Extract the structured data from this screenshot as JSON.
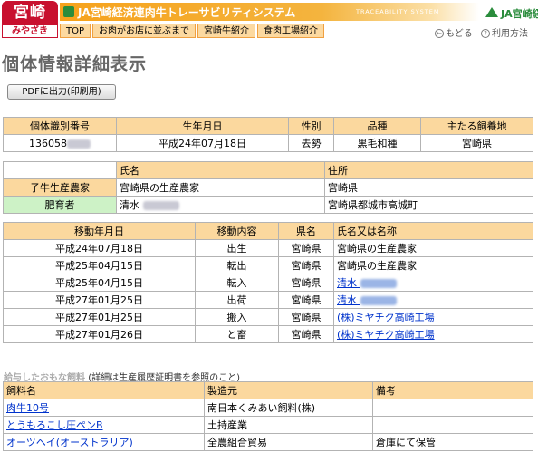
{
  "header": {
    "logo_top": "宮崎",
    "logo_bottom": "みやざき",
    "app_title": "JA宮崎経済連肉牛トレーサビリティシステム",
    "app_subtitle": "TRACEABILITY SYSTEM",
    "brand": "JA宮崎経済連",
    "nav": [
      "TOP",
      "お肉がお店に並ぶまで",
      "宮崎牛紹介",
      "食肉工場紹介"
    ],
    "back_label": "もどる",
    "help_label": "利用方法",
    "accent_color": "#f6a21c",
    "brand_color": "#2a8c3c"
  },
  "page": {
    "title": "個体情報詳細表示",
    "pdf_button": "PDFに出力(印刷用)"
  },
  "cattle": {
    "headers": [
      "個体識別番号",
      "生年月日",
      "性別",
      "品種",
      "主たる飼養地"
    ],
    "row": {
      "id_prefix": "136058",
      "birth": "平成24年07月18日",
      "sex": "去勢",
      "breed": "黒毛和種",
      "location": "宮崎県"
    }
  },
  "farmers": {
    "headers": [
      "氏名",
      "住所"
    ],
    "rows": [
      {
        "label": "子牛生産農家",
        "name": "宮崎県の生産農家",
        "address": "宮崎県"
      },
      {
        "label": "肥育者",
        "name": "清水",
        "address": "宮崎県都城市高城町"
      }
    ]
  },
  "movements": {
    "headers": [
      "移動年月日",
      "移動内容",
      "県名",
      "氏名又は名称"
    ],
    "rows": [
      {
        "date": "平成24年07月18日",
        "type": "出生",
        "pref": "宮崎県",
        "name": "宮崎県の生産農家",
        "link": false,
        "blurred": false
      },
      {
        "date": "平成25年04月15日",
        "type": "転出",
        "pref": "宮崎県",
        "name": "宮崎県の生産農家",
        "link": false,
        "blurred": false
      },
      {
        "date": "平成25年04月15日",
        "type": "転入",
        "pref": "宮崎県",
        "name": "清水",
        "link": true,
        "blurred": true
      },
      {
        "date": "平成27年01月25日",
        "type": "出荷",
        "pref": "宮崎県",
        "name": "清水",
        "link": true,
        "blurred": true
      },
      {
        "date": "平成27年01月25日",
        "type": "搬入",
        "pref": "宮崎県",
        "name": "(株)ミヤチク高崎工場",
        "link": true,
        "blurred": false
      },
      {
        "date": "平成27年01月26日",
        "type": "と畜",
        "pref": "宮崎県",
        "name": "(株)ミヤチク高崎工場",
        "link": true,
        "blurred": false
      }
    ]
  },
  "feed": {
    "heading": "給与したおもな飼料",
    "note": "(詳細は生産履歴証明書を参照のこと)",
    "headers": [
      "飼料名",
      "製造元",
      "備考"
    ],
    "rows": [
      {
        "name": "肉牛10号",
        "maker": "南日本くみあい飼料(株)",
        "note": ""
      },
      {
        "name": "とうもろこし圧ペンB",
        "maker": "土持産業",
        "note": ""
      },
      {
        "name": "オーツヘイ(オーストラリア)",
        "maker": "全農組合貿易",
        "note": "倉庫にて保管"
      }
    ]
  }
}
